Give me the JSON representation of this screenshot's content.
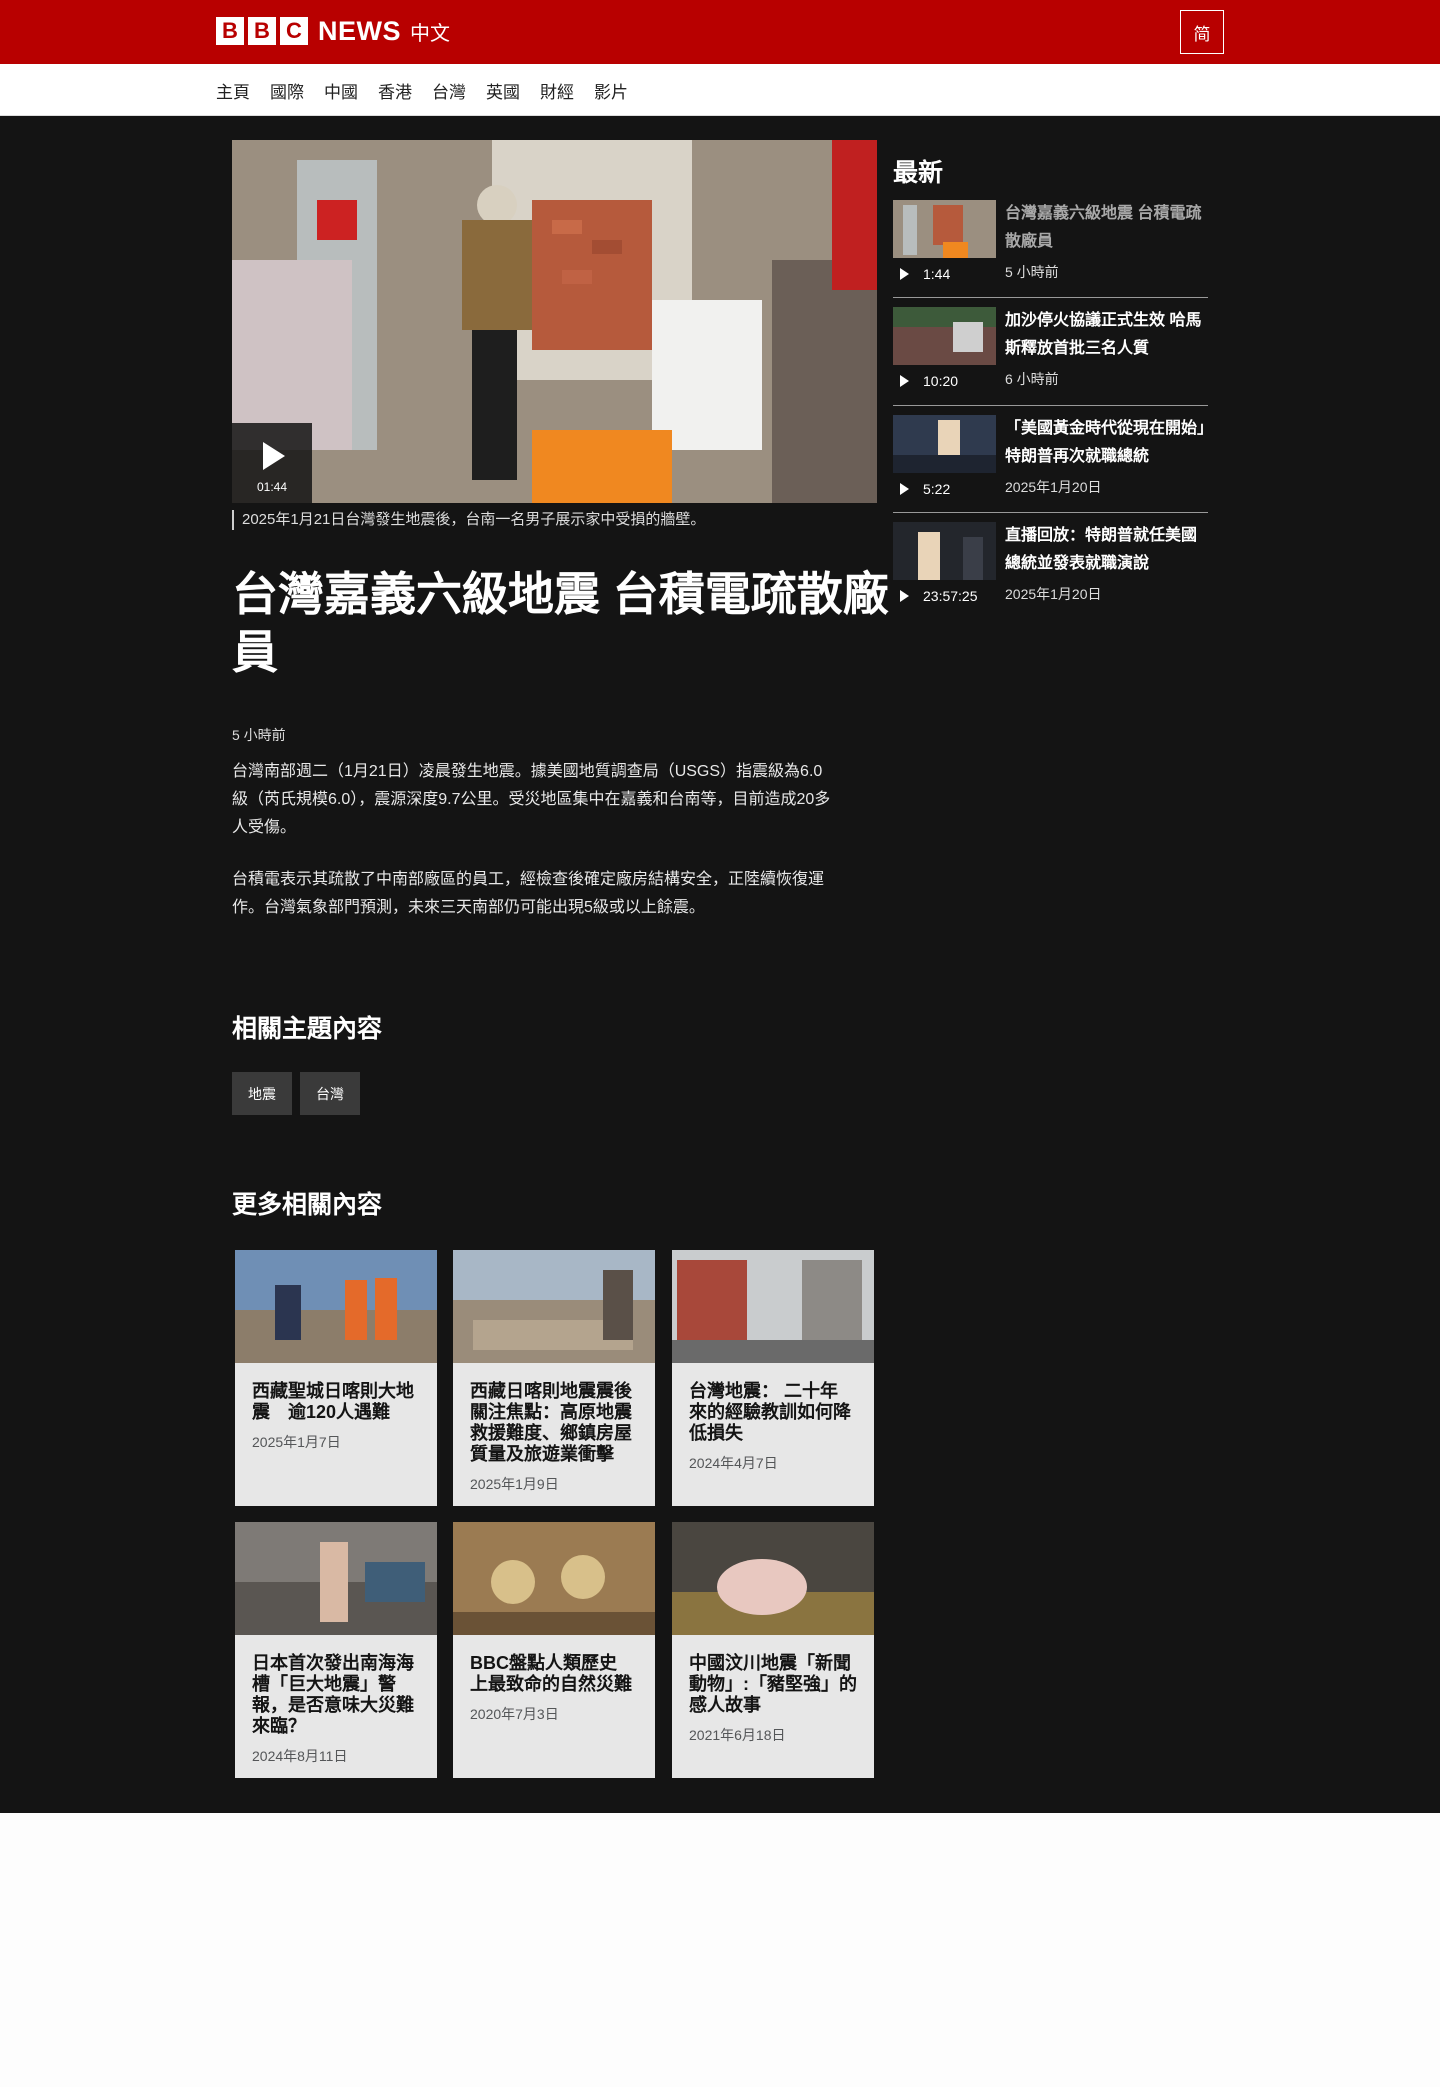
{
  "header": {
    "logo_letters": [
      "B",
      "B",
      "C"
    ],
    "logo_news": "NEWS",
    "logo_lang": "中文",
    "lang_toggle": "简",
    "brand_color": "#b80000"
  },
  "nav": [
    "主頁",
    "國際",
    "中國",
    "香港",
    "台灣",
    "英國",
    "財經",
    "影片"
  ],
  "article": {
    "video_duration": "01:44",
    "caption": "2025年1月21日台灣發生地震後，台南一名男子展示家中受損的牆壁。",
    "title_line1": "台灣嘉義六級地震 台積電疏散廠",
    "title_line2": "員",
    "timestamp": "5 小時前",
    "p1_l1": "台灣南部週二（1月21日）凌晨發生地震。據美國地質調查局（USGS）指震級為6.0",
    "p1_l2": "級（芮氏規模6.0），震源深度9.7公里。受災地區集中在嘉義和台南等，目前造成20多",
    "p1_l3": "人受傷。",
    "p2_l1": "台積電表示其疏散了中南部廠區的員工，經檢查後確定廠房結構安全，正陸續恢復運",
    "p2_l2": "作。台灣氣象部門預測，未來三天南部仍可能出現5級或以上餘震。"
  },
  "related_topics": {
    "title": "相關主題內容",
    "tags": [
      "地震",
      "台灣"
    ]
  },
  "more_related": {
    "title": "更多相關內容",
    "cards": [
      {
        "l1": "西藏聖城日喀則大地",
        "l2": "震　逾120人遇難",
        "l3": "",
        "l4": "",
        "date": "2025年1月7日"
      },
      {
        "l1": "西藏日喀則地震震後",
        "l2": "關注焦點：高原地震",
        "l3": "救援難度、鄉鎮房屋",
        "l4": "質量及旅遊業衝擊",
        "date": "2025年1月9日"
      },
      {
        "l1": "台灣地震： 二十年",
        "l2": "來的經驗教訓如何降",
        "l3": "低損失",
        "l4": "",
        "date": "2024年4月7日"
      },
      {
        "l1": "日本首次發出南海海",
        "l2": "槽「巨大地震」警",
        "l3": "報，是否意味大災難",
        "l4": "來臨？",
        "date": "2024年8月11日"
      },
      {
        "l1": "BBC盤點人類歷史",
        "l2": "上最致命的自然災難",
        "l3": "",
        "l4": "",
        "date": "2020年7月3日"
      },
      {
        "l1": "中國汶川地震「新聞",
        "l2": "動物」:「豬堅強」的",
        "l3": "感人故事",
        "l4": "",
        "date": "2021年6月18日"
      }
    ]
  },
  "sidebar": {
    "title": "最新",
    "items": [
      {
        "l1": "台灣嘉義六級地震 台積電疏",
        "l2": "散廠員",
        "duration": "1:44",
        "date": "5 小時前"
      },
      {
        "l1": "加沙停火協議正式生效 哈馬",
        "l2": "斯釋放首批三名人質",
        "duration": "10:20",
        "date": "6 小時前"
      },
      {
        "l1": "「美國黃金時代從現在開始」",
        "l2": "特朗普再次就職總統",
        "duration": "5:22",
        "date": "2025年1月20日"
      },
      {
        "l1": "直播回放：特朗普就任美國",
        "l2": "總統並發表就職演說",
        "duration": "23:57:25",
        "date": "2025年1月20日"
      }
    ]
  }
}
